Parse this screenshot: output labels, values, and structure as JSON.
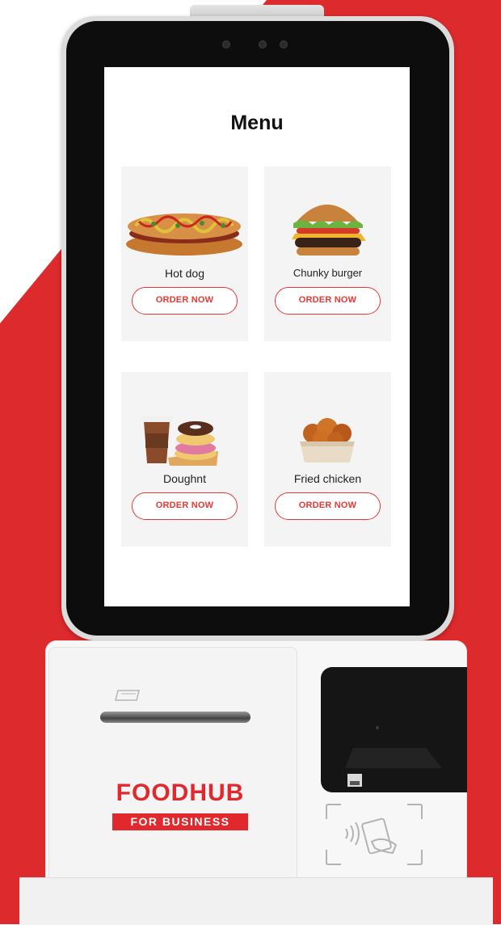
{
  "screen": {
    "title": "Menu",
    "items": [
      {
        "name": "Hot dog",
        "button": "ORDER NOW",
        "image": "hot-dog"
      },
      {
        "name": "Chunky burger",
        "button": "ORDER NOW",
        "image": "burger"
      },
      {
        "name": "Doughnt",
        "button": "ORDER NOW",
        "image": "doughnut-coffee"
      },
      {
        "name": "Fried chicken",
        "button": "ORDER NOW",
        "image": "fried-chicken"
      }
    ]
  },
  "branding": {
    "logo_main": "FOODHUB",
    "logo_sub": "FOR BUSINESS"
  },
  "colors": {
    "brand_red": "#e0282d",
    "button_red": "#e53935"
  }
}
